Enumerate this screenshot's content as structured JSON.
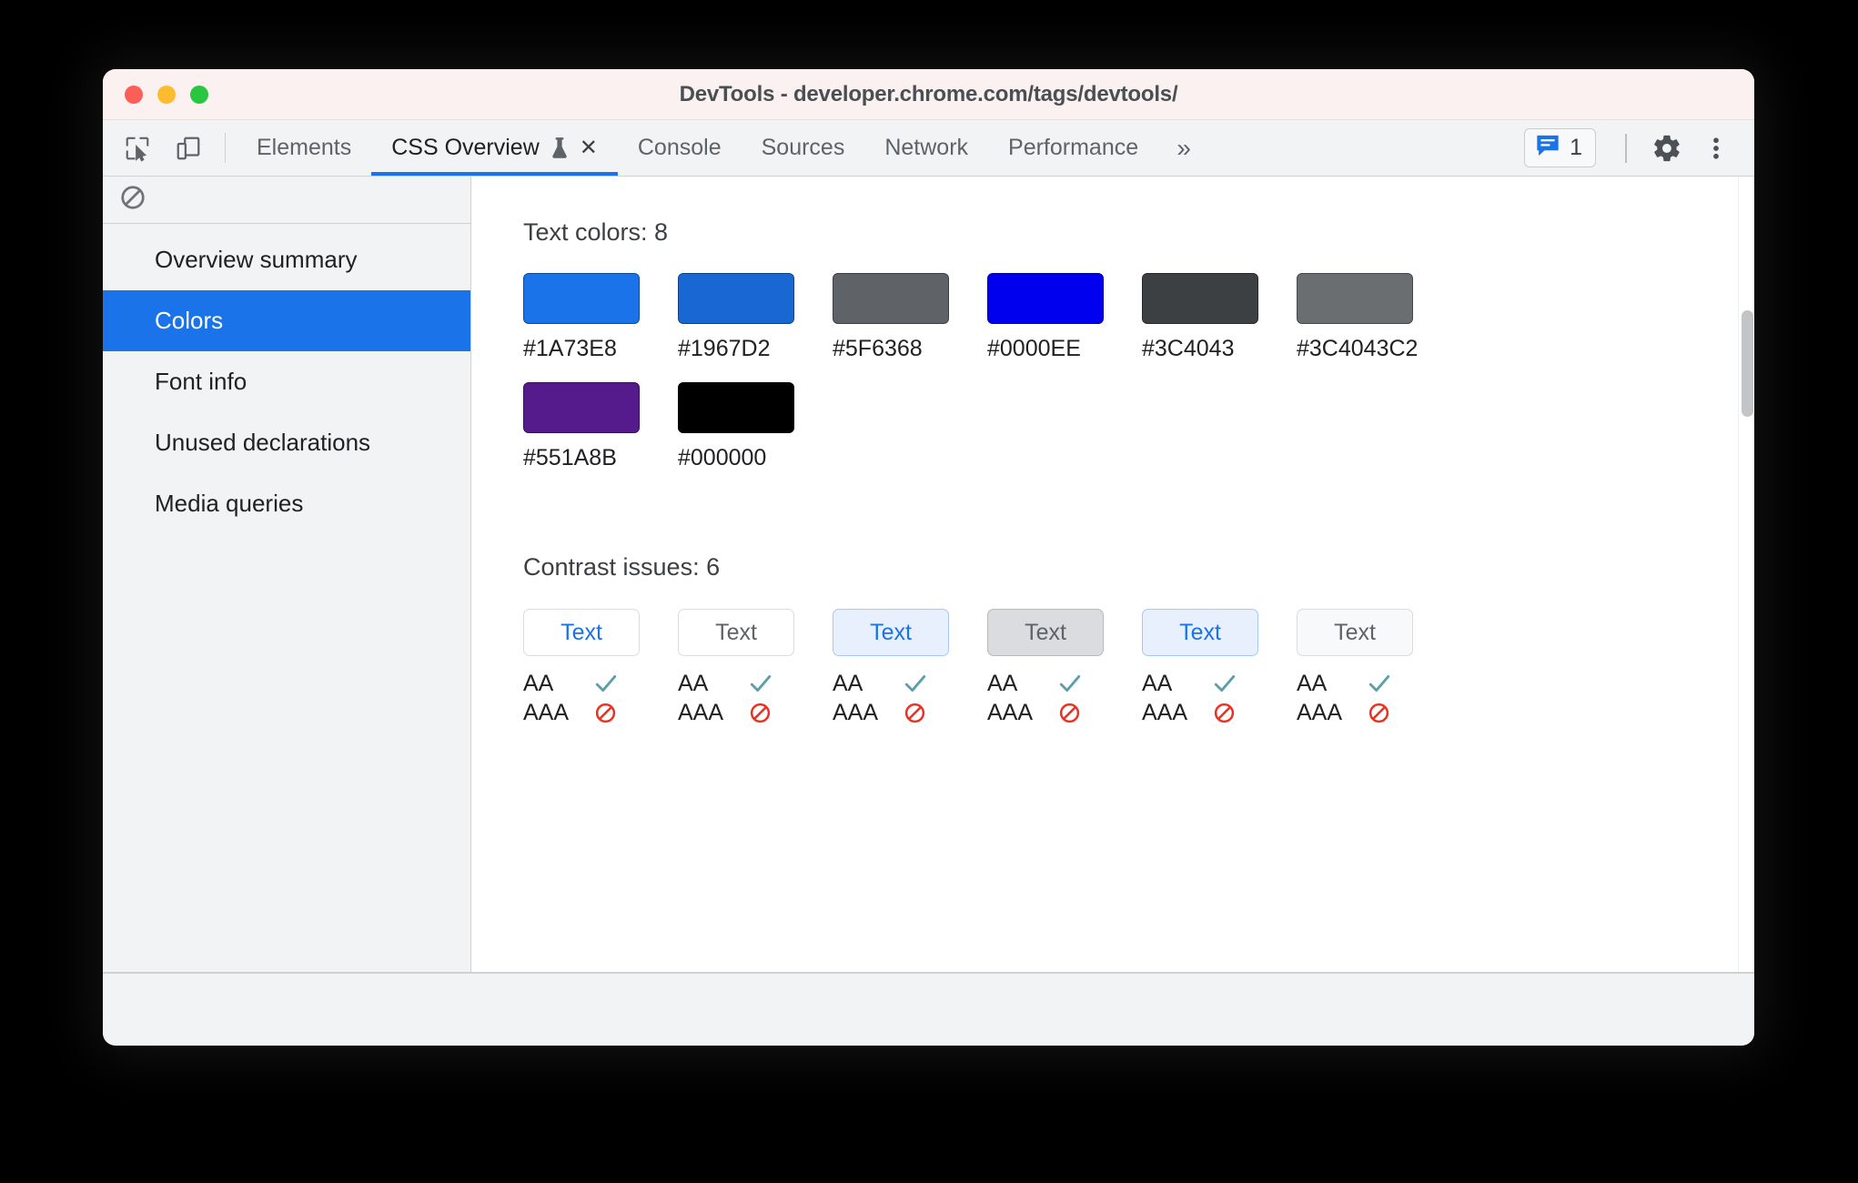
{
  "window": {
    "title": "DevTools - developer.chrome.com/tags/devtools/",
    "traffic_lights": [
      "close-red",
      "minimize-yellow",
      "zoom-green"
    ]
  },
  "tabbar": {
    "left_icons": [
      {
        "name": "inspect-element-icon",
        "label": "Inspect element"
      },
      {
        "name": "device-toolbar-icon",
        "label": "Toggle device toolbar"
      }
    ],
    "tabs": [
      {
        "label": "Elements",
        "active": false
      },
      {
        "label": "CSS Overview",
        "active": true,
        "experimental": true,
        "closable": true
      },
      {
        "label": "Console",
        "active": false
      },
      {
        "label": "Sources",
        "active": false
      },
      {
        "label": "Network",
        "active": false
      },
      {
        "label": "Performance",
        "active": false
      }
    ],
    "overflow_label": "»",
    "close_label": "✕",
    "issues": {
      "count": "1",
      "icon": "issues-speech-bubble-icon",
      "color": "#1a73e8"
    },
    "settings_icon": "gear-icon",
    "more_icon": "kebab-menu-icon"
  },
  "sidebar": {
    "toolbar_icon": "clear-overview-icon",
    "items": [
      {
        "label": "Overview summary",
        "selected": false
      },
      {
        "label": "Colors",
        "selected": true
      },
      {
        "label": "Font info",
        "selected": false
      },
      {
        "label": "Unused declarations",
        "selected": false
      },
      {
        "label": "Media queries",
        "selected": false
      }
    ],
    "selected_color": "#1a73e8"
  },
  "main": {
    "text_colors": {
      "title": "Text colors: 8",
      "swatches": [
        {
          "label": "#1A73E8",
          "color": "#1A73E8"
        },
        {
          "label": "#1967D2",
          "color": "#1967D2"
        },
        {
          "label": "#5F6368",
          "color": "#5F6368"
        },
        {
          "label": "#0000EE",
          "color": "#0000EE"
        },
        {
          "label": "#3C4043",
          "color": "#3C4043"
        },
        {
          "label": "#3C4043C2",
          "color": "#3C4043C2"
        },
        {
          "label": "#551A8B",
          "color": "#551A8B"
        },
        {
          "label": "#000000",
          "color": "#000000"
        }
      ]
    },
    "contrast_issues": {
      "title": "Contrast issues: 6",
      "aa_label": "AA",
      "aaa_label": "AAA",
      "pass_icon": "checkmark-icon",
      "fail_icon": "no-entry-icon",
      "pass_color": "#5b9eae",
      "fail_color": "#ea3323",
      "tiles": [
        {
          "text": "Text",
          "bg": "#ffffff",
          "fg": "#1a73e8",
          "border": "#dadce0",
          "aa": "pass",
          "aaa": "fail"
        },
        {
          "text": "Text",
          "bg": "#ffffff",
          "fg": "#5f6368",
          "border": "#dadce0",
          "aa": "pass",
          "aaa": "fail"
        },
        {
          "text": "Text",
          "bg": "#e8f0fe",
          "fg": "#1a73e8",
          "border": "#a7c7f5",
          "aa": "pass",
          "aaa": "fail"
        },
        {
          "text": "Text",
          "bg": "#dadce0",
          "fg": "#5f6368",
          "border": "#b5b9bd",
          "aa": "pass",
          "aaa": "fail"
        },
        {
          "text": "Text",
          "bg": "#e8f0fe",
          "fg": "#1a73e8",
          "border": "#a7c7f5",
          "aa": "pass",
          "aaa": "fail"
        },
        {
          "text": "Text",
          "bg": "#f8f9fa",
          "fg": "#5f6368",
          "border": "#dadce0",
          "aa": "pass",
          "aaa": "fail"
        }
      ]
    }
  }
}
